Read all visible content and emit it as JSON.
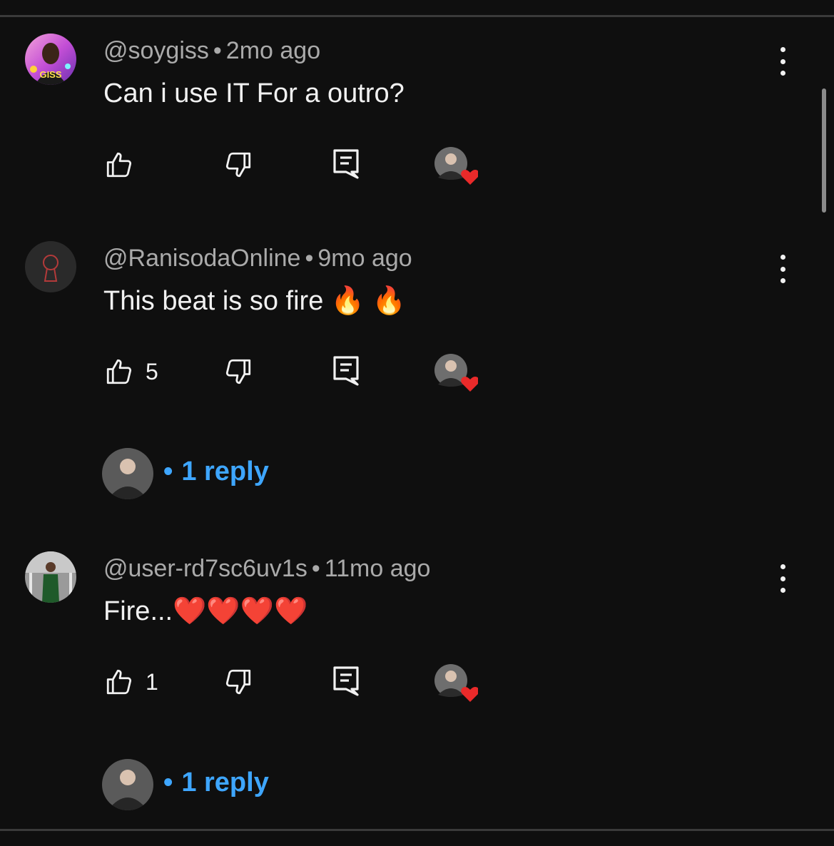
{
  "comments": [
    {
      "author": "@soygiss",
      "time": "2mo ago",
      "text": "Can i use IT For a outro?",
      "likes": "",
      "avatar_label": "GISS"
    },
    {
      "author": "@RanisodaOnline",
      "time": "9mo ago",
      "text": "This beat is so fire 🔥 🔥",
      "likes": "5",
      "replies_label": "1 reply"
    },
    {
      "author": "@user-rd7sc6uv1s",
      "time": "11mo ago",
      "text": "Fire...❤️❤️❤️❤️",
      "likes": "1",
      "replies_label": "1 reply"
    }
  ],
  "separator": "•",
  "colors": {
    "background": "#0f0f0f",
    "link": "#3ea6ff",
    "meta": "#aaaaaa",
    "heart": "#ea2a2a"
  }
}
